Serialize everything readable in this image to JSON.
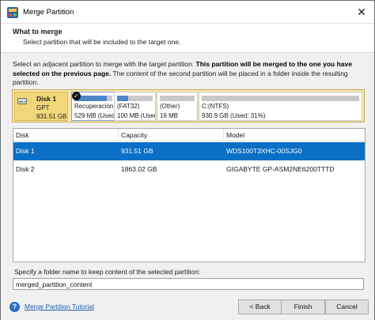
{
  "window": {
    "title": "Merge Partition",
    "close_glyph": "✕"
  },
  "header": {
    "title": "What to merge",
    "subtitle": "Select partition that will be included to the target one."
  },
  "description": {
    "part1": "Select an adjacent partition to merge with the target partition. ",
    "bold": "This partition will be merged to the one you have selected on the previous page.",
    "part2": " The content of the second partition will be placed in a folder inside the resulting partition."
  },
  "disk_map": {
    "disk": {
      "name": "Disk 1",
      "type": "GPT",
      "size": "931.51 GB"
    },
    "partitions": [
      {
        "name": "Recuperación",
        "size": "529 MB (Used:",
        "used_fraction": 0.85,
        "selected": true
      },
      {
        "name": "(FAT32)",
        "size": "100 MB (Used:",
        "used_fraction": 0.3,
        "selected": false
      },
      {
        "name": "(Other)",
        "size": "16 MB",
        "used_fraction": 1.0,
        "selected": false
      },
      {
        "name": "C:(NTFS)",
        "size": "930.9 GB (Used: 31%)",
        "used_fraction": 0.31,
        "selected": false
      }
    ]
  },
  "disk_table": {
    "headers": [
      "Disk",
      "Capacity",
      "Model"
    ],
    "rows": [
      {
        "disk": "Disk 1",
        "capacity": "931.51 GB",
        "model": "WDS100T3XHC-00SJG0",
        "selected": true
      },
      {
        "disk": "Disk 2",
        "capacity": "1863.02 GB",
        "model": "GIGABYTE GP-ASM2NE6200TTTD",
        "selected": false
      }
    ]
  },
  "folder": {
    "label": "Specify a folder name to keep content of the selected partition:",
    "value": "merged_partition_content"
  },
  "footer": {
    "tutorial_link": "Merge Partition Tutorial",
    "help_glyph": "?",
    "back_label": "< Back",
    "finish_label": "Finish",
    "cancel_label": "Cancel"
  },
  "colors": {
    "selection": "#0b6fc6",
    "disk_map_bg": "#f7e9b4",
    "usage_fill": "#4a86c8",
    "link": "#1c5fb4"
  }
}
